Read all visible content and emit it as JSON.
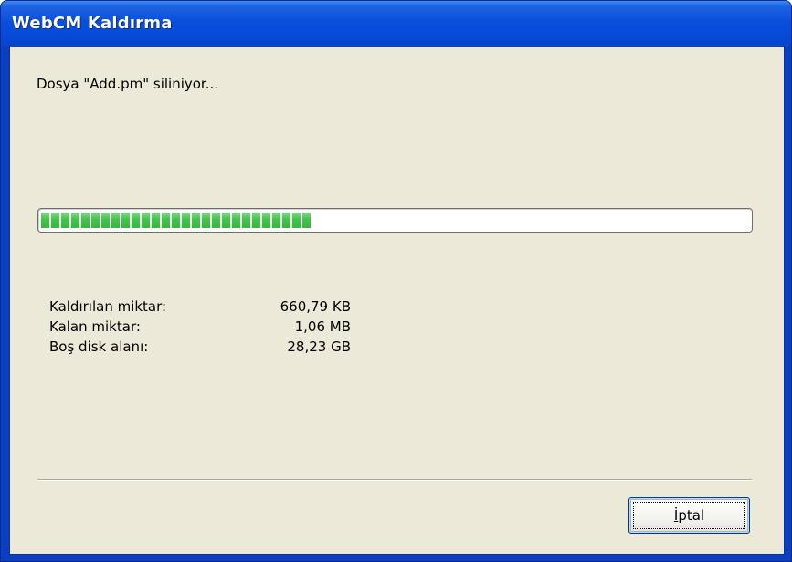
{
  "window": {
    "title": "WebCM Kaldırma"
  },
  "status": {
    "message": "Dosya \"Add.pm\" siliniyor..."
  },
  "progress": {
    "fraction": 0.385,
    "color": "#3ec448"
  },
  "stats": [
    {
      "label": "Kaldırılan miktar:",
      "value": "660,79 KB"
    },
    {
      "label": "Kalan miktar:",
      "value": "1,06 MB"
    },
    {
      "label": "Boş disk alanı:",
      "value": "28,23 GB"
    }
  ],
  "buttons": {
    "cancel": {
      "mnemonic": "İ",
      "rest": "ptal"
    }
  },
  "colors": {
    "title_bar": "#0a4fdc",
    "dialog_background": "#ece9d8"
  }
}
